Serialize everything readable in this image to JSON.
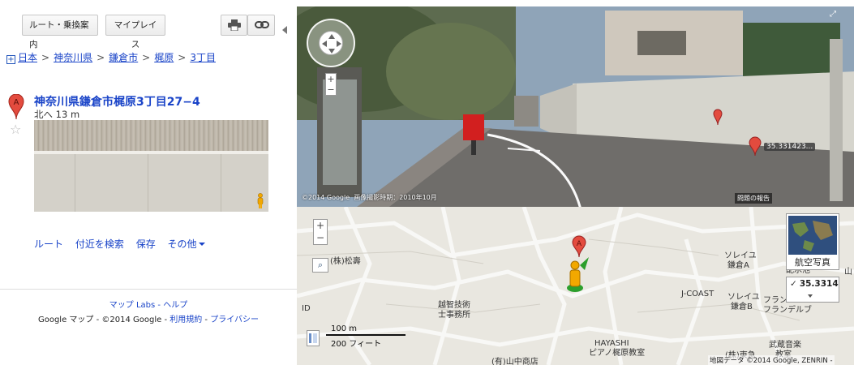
{
  "toolbar": {
    "route_label": "ルート・乗換案内",
    "myplaces_label": "マイプレイス",
    "print_icon": "printer-icon",
    "link_icon": "link-icon"
  },
  "breadcrumb": [
    "日本",
    "神奈川県",
    "鎌倉市",
    "梶原",
    "3丁目"
  ],
  "place": {
    "marker": "A",
    "title": "神奈川県鎌倉市梶原3丁目27−4",
    "heading": "北へ 13 m"
  },
  "actions": {
    "route": "ルート",
    "nearby": "付近を検索",
    "save": "保存",
    "more": "その他"
  },
  "footer": {
    "labs": "マップ Labs",
    "sep": " - ",
    "help": "ヘルプ",
    "brand": "Google マップ",
    "dash": " - ",
    "copyright": "©2014 Google",
    "terms": "利用規約",
    "privacy": "プライバシー"
  },
  "streetview": {
    "copyright": "©2014 Google",
    "capture_date": "画像撮影時期：2010年10月",
    "report": "問題の報告",
    "marker_label": "35.331423...",
    "marker": "A"
  },
  "map": {
    "zoom_in": "+",
    "zoom_out": "−",
    "scale_metric": "100 m",
    "scale_imperial": "200 フィート",
    "satellite_label": "航空写真",
    "coord_value": "35.3314",
    "marker": "A",
    "labels": {
      "shouju": "(株)松壽",
      "ochi1": "越智技術",
      "ochi2": "士事務所",
      "hayashi1": "HAYASHI",
      "hayashi2": "ピアノ梶原教室",
      "jcoast": "J-COAST",
      "soleil_a1": "ソレイユ",
      "soleil_a2": "鎌倉A",
      "soleil_b1": "ソレイユ",
      "soleil_b2": "鎌倉B",
      "fran1": "フラン",
      "fran2": "フランデルブ",
      "musashi1": "武蔵音楽",
      "musashi2": "教室",
      "kasho": "配水池",
      "ya": "山",
      "id": "ID",
      "bottom": "(有)山中商店",
      "tokyu": "(株)東急"
    },
    "copyright": "地図データ ©2014 Google, ZENRIN -"
  }
}
